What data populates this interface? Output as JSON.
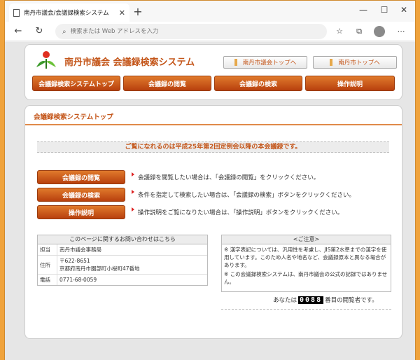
{
  "browser": {
    "tab_title": "南丹市議会/会議録検索システム",
    "address_placeholder": "検索または Web アドレスを入力"
  },
  "site": {
    "title": "南丹市議会 会議録検索システム",
    "top_links": [
      "南丹市議会トップへ",
      "南丹市トップへ"
    ],
    "nav": [
      "会議録検索システムトップ",
      "会議録の閲覧",
      "会議録の検索",
      "操作説明"
    ]
  },
  "main": {
    "section_title": "会議録検索システムトップ",
    "notice": "ご覧になれるのは平成25年第2回定例会以降の本会議録です。",
    "actions": [
      {
        "label": "会議録の閲覧",
        "desc": "会議録を閲覧したい場合は、「会議録の閲覧」をクリックください。"
      },
      {
        "label": "会議録の検索",
        "desc": "条件を指定して検索したい場合は、「会議録の検索」ボタンをクリックください。"
      },
      {
        "label": "操作説明",
        "desc": "操作説明をご覧になりたい場合は、「操作説明」ボタンをクリックください。"
      }
    ],
    "contact": {
      "title": "このページに関するお問い合わせはこちら",
      "rows": [
        {
          "k": "担当",
          "v": "南丹市議会事務局"
        },
        {
          "k": "住所",
          "v1": "〒622-8651",
          "v2": "京都府南丹市園部町小桜町47番地"
        },
        {
          "k": "電話",
          "v": "0771-68-0059"
        }
      ]
    },
    "caution": {
      "title": "<ご注意>",
      "lines": [
        "※ 漢字表記については、汎用性を考慮し、JIS第2水準までの漢字を使用しています。このため人名や地名など、会議録原本と異なる場合があります。",
        "※ この会議録検索システムは、南丹市議会の公式の記録ではありません。"
      ]
    },
    "counter": {
      "prefix": "あなたは",
      "number": "0088",
      "suffix": "番目の閲覧者です。"
    }
  }
}
